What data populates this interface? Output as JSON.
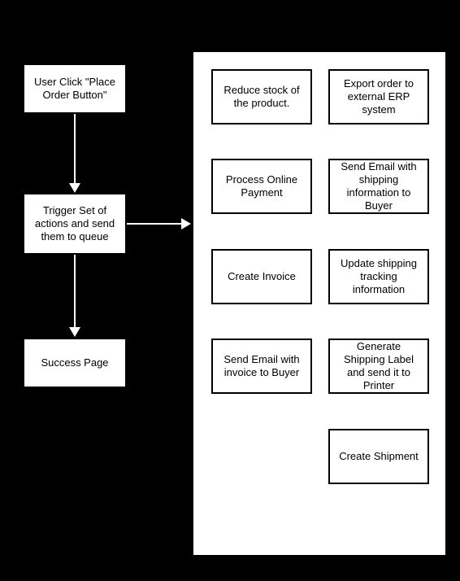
{
  "flow": {
    "step1": "User Click \"Place Order Button\"",
    "step2": "Trigger Set of actions and send them to queue",
    "step3": "Success Page"
  },
  "actions": {
    "a1": "Reduce stock of the product.",
    "a2": "Process Online Payment",
    "a3": "Create Invoice",
    "a4": "Send Email with invoice to Buyer",
    "b1": "Export order to external ERP system",
    "b2": "Send Email with shipping information to Buyer",
    "b3": "Update shipping tracking information",
    "b4": "Generate Shipping Label and send it to Printer",
    "b5": "Create Shipment"
  }
}
